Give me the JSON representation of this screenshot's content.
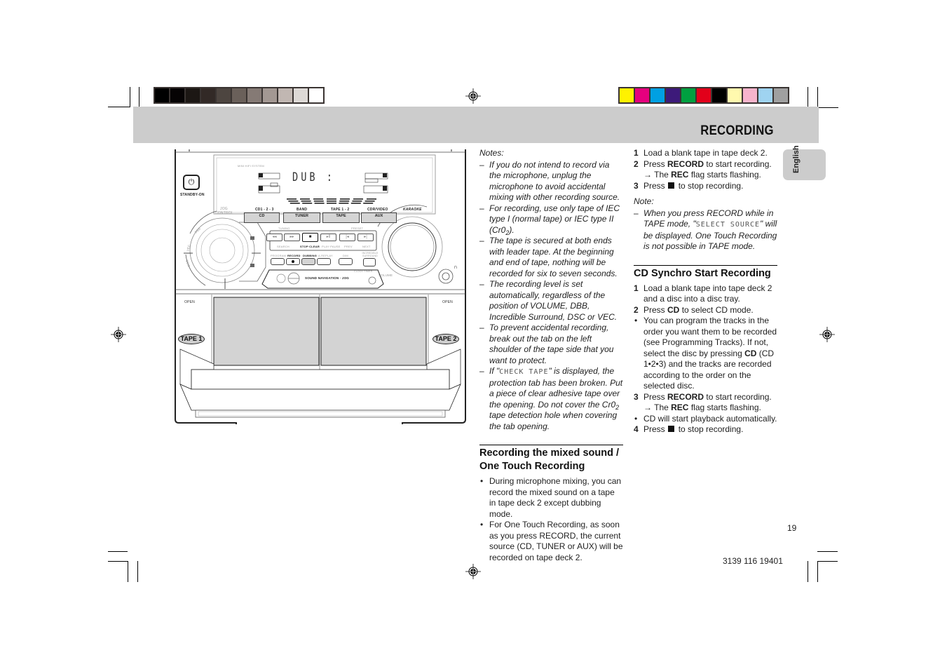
{
  "header": {
    "title": "RECORDING",
    "language_tab": "English"
  },
  "print_marks": {
    "grayscale_swatches": [
      "#000000",
      "#060304",
      "#1c1714",
      "#322926",
      "#4d4540",
      "#6a605a",
      "#857a75",
      "#a39893",
      "#c1b7b2",
      "#ddd9d6",
      "#ffffff"
    ],
    "color_swatches": [
      "#fff200",
      "#e6007e",
      "#00a0e3",
      "#3d1a7a",
      "#00a040",
      "#e2001a",
      "#000000",
      "#fff9ae",
      "#f7b4cc",
      "#9fd3f0",
      "#a0a0a0"
    ]
  },
  "device": {
    "brand_line": "MINI HIFI SYSTEM",
    "display_text": "DUB   :",
    "standby_label": "STANDBY-ON",
    "jog_label_1": "JOG",
    "jog_label_2": "CONTROL",
    "karaoke_label": "KARAOKE",
    "sources": [
      {
        "top": "CD1 - 2 - 3",
        "button": "CD"
      },
      {
        "top": "BAND",
        "button": "TUNER"
      },
      {
        "top": "TAPE 1 - 2",
        "button": "TAPE"
      },
      {
        "top": "CDR/VIDEO",
        "button": "AUX"
      }
    ],
    "tuning_label": "TUNING",
    "preset_label": "PRESET",
    "transport_labels": [
      "SEARCH",
      "STOP·CLEAR",
      "PLAY·PAUSE",
      "PREV",
      "NEXT"
    ],
    "transport_icons": [
      "◂◂",
      "▸▸",
      "■",
      "▸‖",
      "|◂",
      "▸|"
    ],
    "function_labels": [
      "PROGRAM",
      "RECORD",
      "DUBBING",
      "A.REPLAY",
      "DIM",
      "INCREDIBLE SURROUND"
    ],
    "sound_nav_label": "SOUND NAVIGATION · JOG",
    "clock_timer_label": "CLOCK·TIMER",
    "volume_label": "VOLUME",
    "dial_labels": [
      "VEC",
      "DSC",
      "DBB"
    ],
    "open_left": "OPEN",
    "open_right": "OPEN",
    "tape1_label": "TAPE 1",
    "tape2_label": "TAPE 2"
  },
  "column1": {
    "notes_label": "Notes:",
    "notes": [
      "If you do not intend to record via the microphone, unplug the microphone to avoid accidental mixing with other recording source.",
      "For recording, use only tape of IEC type I (normal tape) or IEC type II (Cr0",
      "The tape is secured at both ends with leader tape.  At the beginning and end of tape, nothing will be recorded for six to seven seconds.",
      "The recording level is set automatically, regardless of the position of VOLUME, DBB, Incredible Surround, DSC or VEC.",
      "To prevent accidental recording, break out the tab on the left shoulder of the tape side that you want to protect."
    ],
    "note2_sub": "2",
    "note2_end": ").",
    "note6_prefix": "If \"",
    "note6_lcd": "CHECK TAPE",
    "note6_mid": "\" is displayed, the protection tab has been broken. Put a piece of clear adhesive tape over the opening.  Do not cover the Cr0",
    "note6_sub": "2",
    "note6_end": " tape detection hole when covering the tab opening.",
    "section_title": "Recording the mixed sound / One Touch Recording",
    "bullets": [
      "During microphone mixing, you can record the mixed sound on a tape in tape deck 2 except dubbing mode.",
      "For One Touch Recording, as soon as you press RECORD, the current source (CD, TUNER or AUX) will be recorded on tape deck 2."
    ]
  },
  "column2": {
    "steps": [
      {
        "n": "1",
        "text": "Load a blank tape in tape deck 2."
      },
      {
        "n": "2",
        "pre": "Press ",
        "bold": "RECORD",
        "post": " to start recording."
      },
      {
        "n": "3",
        "pre": "Press",
        "post": "to stop recording."
      }
    ],
    "arrow_pre": "→ The ",
    "arrow_bold": "REC",
    "arrow_post": " flag starts flashing.",
    "note_label": "Note:",
    "note_pre": "When you press RECORD while in TAPE mode, \"",
    "note_lcd": "SELECT SOURCE",
    "note_post": "\" will be displayed.  One Touch Recording is not possible in TAPE mode.",
    "section_title": "CD Synchro Start Recording",
    "cd_steps": {
      "s1_n": "1",
      "s1": "Load a blank tape into tape deck 2 and a disc into a disc tray.",
      "s2_n": "2",
      "s2_pre": "Press ",
      "s2_bold": "CD",
      "s2_post": " to select CD mode.",
      "b1_pre": "You can program the tracks in the order you want them to be recorded (see Programming Tracks). If not,  select the disc by pressing ",
      "b1_bold": "CD",
      "b1_post": " (CD 1•2•3) and the tracks are recorded according to the order on the selected disc.",
      "s3_n": "3",
      "s3_pre": "Press ",
      "s3_bold": "RECORD",
      "s3_post": " to start recording.",
      "arrow_pre": "→ The ",
      "arrow_bold": "REC",
      "arrow_post": " flag starts flashing.",
      "b2": "CD will start playback automatically.",
      "s4_n": "4",
      "s4_pre": "Press",
      "s4_post": "to stop recording."
    }
  },
  "footer": {
    "page_number": "19",
    "document_code": "3139 116 19401"
  }
}
